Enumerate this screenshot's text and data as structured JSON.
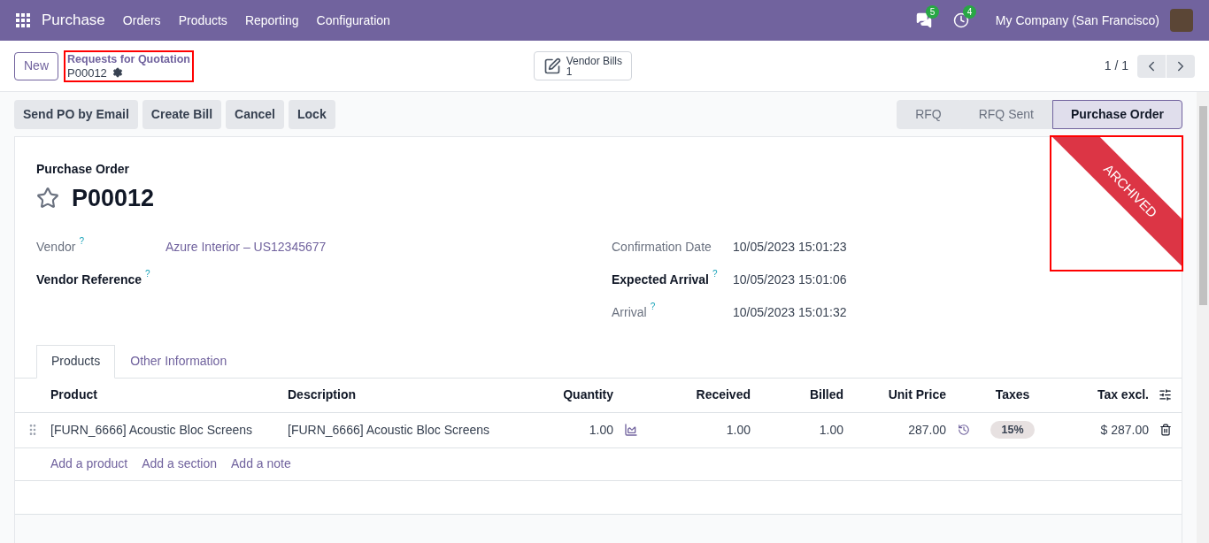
{
  "navbar": {
    "app_name": "Purchase",
    "menu": [
      "Orders",
      "Products",
      "Reporting",
      "Configuration"
    ],
    "messages_count": "5",
    "activities_count": "4",
    "company": "My Company (San Francisco)"
  },
  "control_panel": {
    "new_button": "New",
    "breadcrumb": "Requests for Quotation",
    "record": "P00012",
    "vendor_bills": {
      "label": "Vendor Bills",
      "count": "1"
    },
    "pager": "1 / 1"
  },
  "actions": [
    "Send PO by Email",
    "Create Bill",
    "Cancel",
    "Lock"
  ],
  "statusbar": [
    {
      "label": "RFQ",
      "selected": false
    },
    {
      "label": "RFQ Sent",
      "selected": false
    },
    {
      "label": "Purchase Order",
      "selected": true
    }
  ],
  "ribbon": "ARCHIVED",
  "form": {
    "title_label": "Purchase Order",
    "name": "P00012",
    "starred": false,
    "left_fields": [
      {
        "label": "Vendor",
        "value": "Azure Interior – US12345677",
        "required": false,
        "help": "?",
        "link": true
      },
      {
        "label": "Vendor Reference",
        "required": true,
        "help": "?"
      }
    ],
    "right_fields": [
      {
        "label": "Confirmation Date",
        "value": "10/05/2023 15:01:23",
        "required": false,
        "link": false
      },
      {
        "label": "Expected Arrival",
        "value": "10/05/2023 15:01:06",
        "required": true,
        "help": "?",
        "link": false
      },
      {
        "label": "Arrival",
        "value": "10/05/2023 15:01:32",
        "required": false,
        "help": "?",
        "link": false
      }
    ]
  },
  "tabs": [
    {
      "label": "Products",
      "selected": true
    },
    {
      "label": "Other Information",
      "selected": false
    }
  ],
  "table": {
    "columns": [
      "Product",
      "Description",
      "Quantity",
      "Received",
      "Billed",
      "Unit Price",
      "Taxes",
      "Tax excl."
    ],
    "rows": [
      {
        "product": "[FURN_6666] Acoustic Bloc Screens",
        "description": "[FURN_6666] Acoustic Bloc Screens",
        "quantity": "1.00",
        "received": "1.00",
        "billed": "1.00",
        "unit_price": "287.00",
        "taxes": "15%",
        "total": "$ 287.00"
      }
    ],
    "add_links": [
      "Add a product",
      "Add a section",
      "Add a note"
    ]
  }
}
